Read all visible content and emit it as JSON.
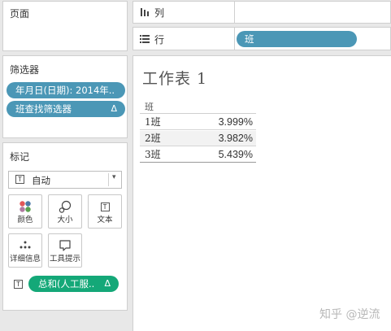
{
  "pages_shelf": {
    "title": "页面"
  },
  "columns_shelf": {
    "icon": "columns-icon",
    "label": "列"
  },
  "rows_shelf": {
    "icon": "rows-icon",
    "label": "行",
    "pill": "班"
  },
  "filters": {
    "title": "筛选器",
    "items": [
      {
        "label": "年月日(日期): 2014年..",
        "delta": ""
      },
      {
        "label": "班查找筛选器",
        "delta": "Δ"
      }
    ]
  },
  "marks": {
    "title": "标记",
    "mark_type": {
      "icon": "T",
      "value": "自动",
      "arrow": "▾"
    },
    "buttons": [
      {
        "name": "color-button",
        "icon": "color-dots-icon",
        "label": "颜色"
      },
      {
        "name": "size-button",
        "icon": "size-icon",
        "label": "大小"
      },
      {
        "name": "text-button",
        "icon": "text-icon",
        "label": "文本"
      },
      {
        "name": "detail-button",
        "icon": "detail-dots-icon",
        "label": "详细信息"
      },
      {
        "name": "tooltip-button",
        "icon": "tooltip-icon",
        "label": "工具提示"
      }
    ],
    "field": {
      "icon": "T",
      "label": "总和(人工服..",
      "delta": "Δ"
    }
  },
  "worksheet": {
    "title": "工作表 1",
    "column_header": "班",
    "rows": [
      {
        "label": "1班",
        "value": "3.999%"
      },
      {
        "label": "2班",
        "value": "3.982%"
      },
      {
        "label": "3班",
        "value": "5.439%"
      }
    ]
  },
  "watermark": "知乎 @逆流",
  "colors": {
    "pill_blue": "#4b97b6",
    "pill_green": "#14a878",
    "dot_colors": [
      "#e15759",
      "#4e79a7",
      "#b07aa1",
      "#59a14f"
    ]
  }
}
